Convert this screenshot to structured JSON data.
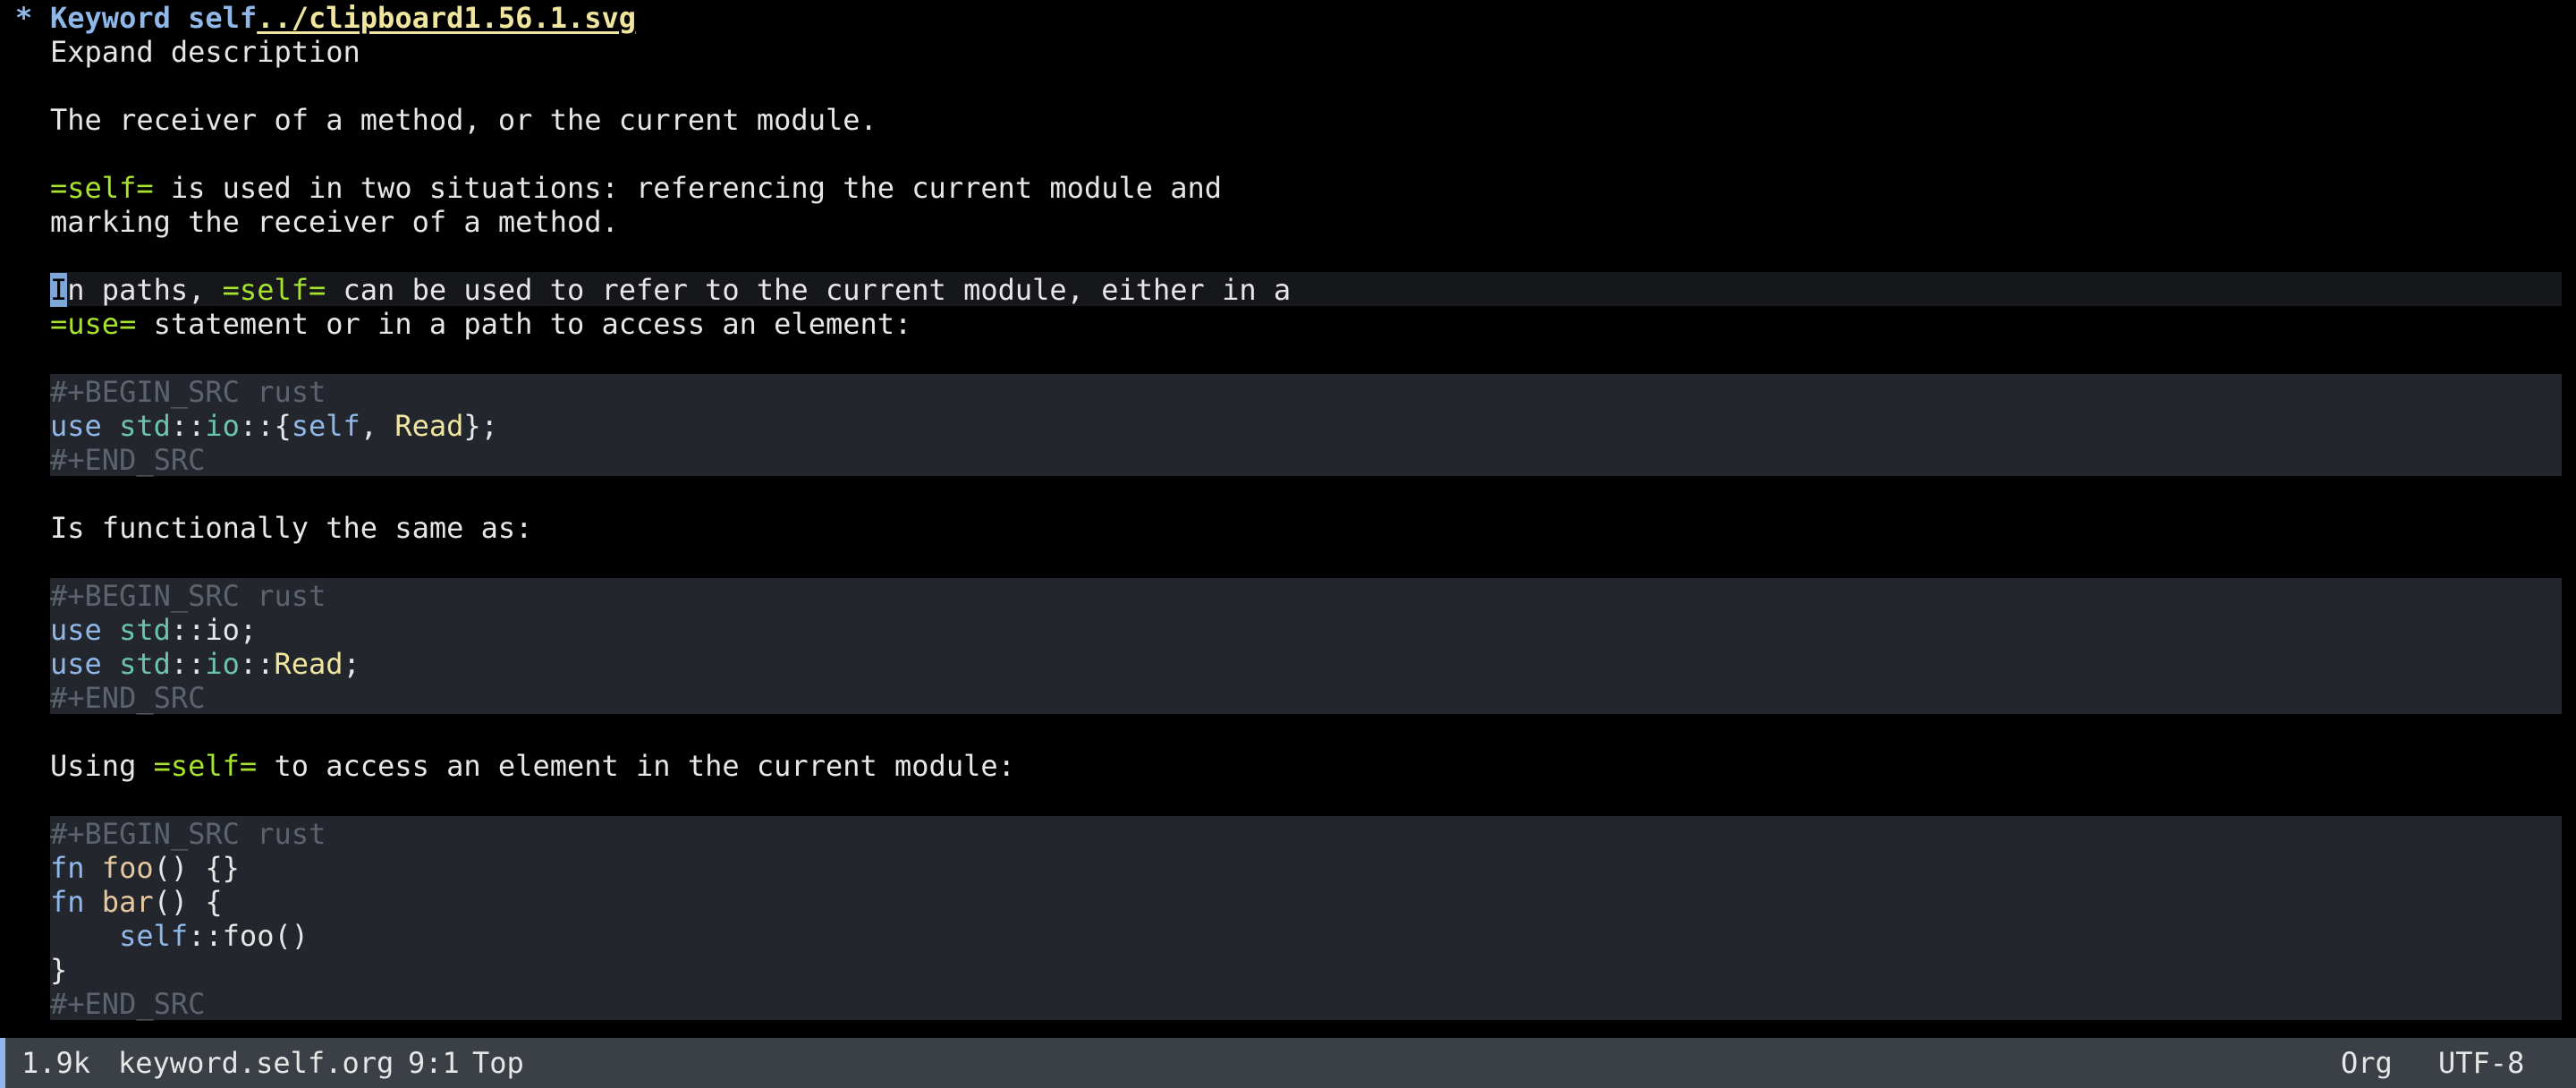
{
  "heading": {
    "star": "*",
    "title": "Keyword self",
    "link": "../clipboard1.56.1.svg"
  },
  "lines": {
    "expand": "Expand description",
    "intro": "The receiver of a method, or the current module.",
    "self_verbatim": "=self=",
    "situations_rest": " is used in two situations: referencing the current module and",
    "situations_cont": "marking the receiver of a method.",
    "paths_cursor_char": "I",
    "paths_pre": "n paths, ",
    "paths_rest": " can be used to refer to the current module, either in a",
    "use_verbatim": "=use=",
    "use_rest": " statement or in a path to access an element:",
    "functionally": "Is functionally the same as:",
    "using_pre": "Using ",
    "using_rest": " to access an element in the current module:"
  },
  "src": {
    "begin": "#+BEGIN_SRC rust",
    "end": "#+END_SRC",
    "kw_use": "use",
    "kw_fn": "fn",
    "kw_self": "self",
    "std": "std",
    "io": "io",
    "sep": "::",
    "read": "Read",
    "brace_open": "{",
    "brace_close": "}",
    "comma": ", ",
    "semi_brace": "};",
    "semi": ";",
    "foo": "foo",
    "bar": "bar",
    "foo_sig_rest": "() {}",
    "bar_sig_rest": "() {",
    "self_call_rest": "::foo()",
    "indent": "    ",
    "closing_brace": "}"
  },
  "modeline": {
    "size": "1.9k",
    "filename": "keyword.self.org",
    "position": "9:1",
    "scroll": "Top",
    "major_mode": "Org",
    "encoding": "UTF-8"
  },
  "colors": {
    "background": "#000000",
    "code_block_bg": "#23262c",
    "heading": "#8fb8e8",
    "link": "#f0e6a0",
    "verbatim": "#a6e22e",
    "modeline_bg": "#3b3f46"
  }
}
